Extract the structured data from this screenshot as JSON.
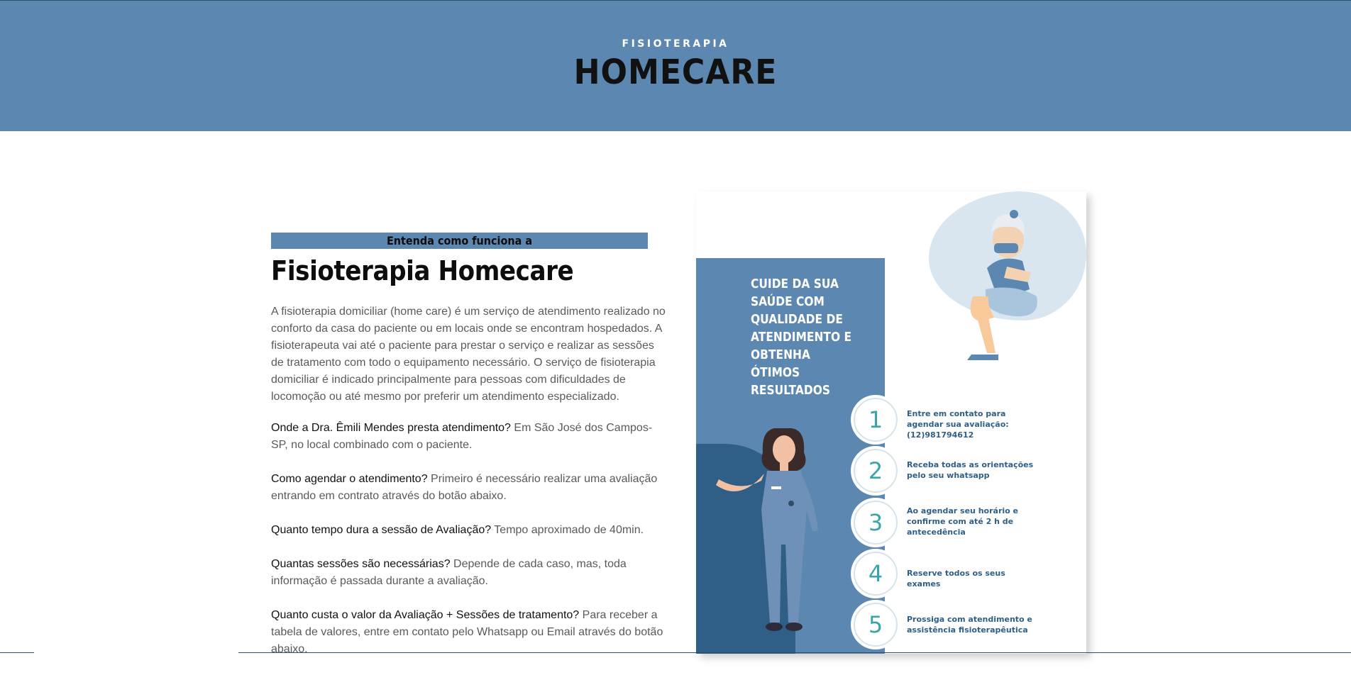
{
  "hero": {
    "kicker": "FISIOTERAPIA",
    "title": "HOMECARE",
    "background": "#5b87b0"
  },
  "section": {
    "band_label": "Entenda como funciona a",
    "title": "Fisioterapia Homecare",
    "intro": "A fisioterapia domiciliar (home care) é um serviço de atendimento realizado no conforto da casa do paciente ou em locais onde se encontram hospedados. A fisioterapeuta vai até o paciente para prestar o serviço e realizar as sessões de tratamento com todo o equipamento necessário. O serviço de fisioterapia domiciliar é indicado principalmente para pessoas com dificuldades de locomoção ou até mesmo por preferir um atendimento especializado.",
    "faq": [
      {
        "q": "Onde a Dra. Êmili Mendes presta atendimento?",
        "a": " Em São José dos Campos-SP, no local combinado com o paciente."
      },
      {
        "q": "Como agendar o atendimento?",
        "a": " Primeiro é necessário realizar uma avaliação entrando em contrato através do botão abaixo."
      },
      {
        "q": "Quanto tempo dura a sessão de Avaliação?",
        "a": " Tempo aproximado de 40min."
      },
      {
        "q": "Quantas sessões são necessárias?",
        "a": " Depende de cada caso, mas, toda informação é passada durante a avaliação."
      },
      {
        "q": "Quanto custa o valor da Avaliação + Sessões de tratamento?",
        "a": " Para receber a tabela de valores, entre em contato pelo Whatsapp ou Email através do botão abaixo."
      }
    ]
  },
  "card": {
    "heading": "CUIDE DA SUA SAÚDE COM QUALIDADE DE ATENDIMENTO E OBTENHA ÓTIMOS RESULTADOS",
    "steps": [
      {
        "number": "1",
        "text": "Entre em contato para agendar sua avaliação: (12)981794612"
      },
      {
        "number": "2",
        "text": "Receba todas as orientações pelo seu whatsapp"
      },
      {
        "number": "3",
        "text": "Ao agendar seu horário e confirme com até 2 h de antecedência"
      },
      {
        "number": "4",
        "text": "Reserve todos os seus exames"
      },
      {
        "number": "5",
        "text": "Prossiga com atendimento e assistência fisioterapêutica"
      }
    ],
    "accent_color": "#3aa5a8",
    "dark_blue": "#2f5e87"
  }
}
